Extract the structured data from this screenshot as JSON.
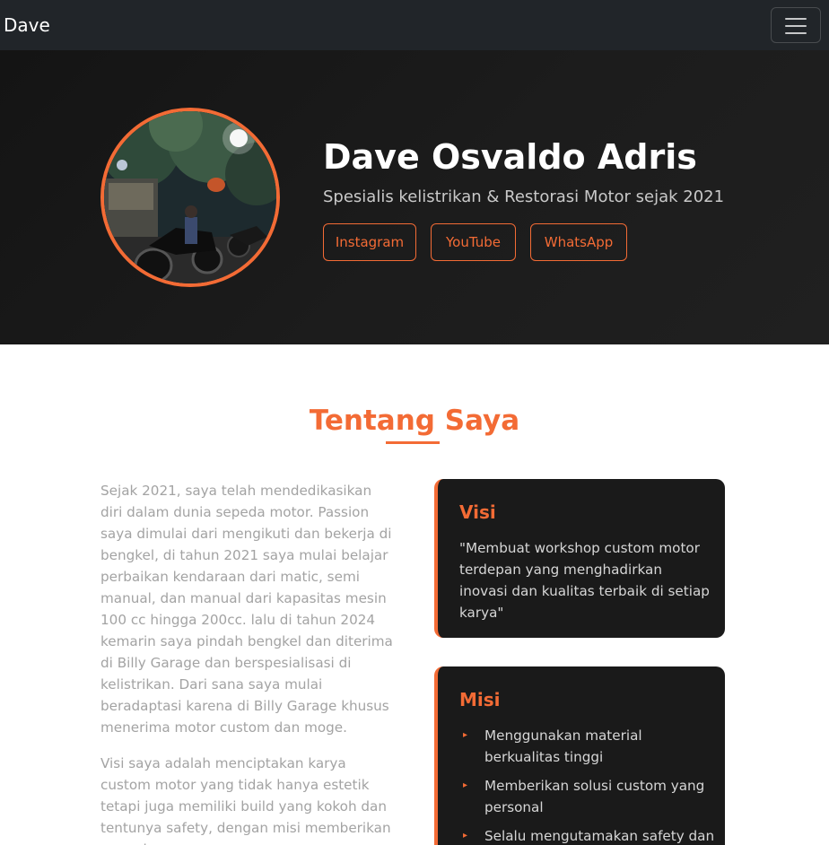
{
  "navbar": {
    "brand": "Dave",
    "toggle_icon": "hamburger-menu-icon"
  },
  "hero": {
    "name": "Dave Osvaldo Adris",
    "subtitle": "Spesialis kelistrikan & Restorasi Motor sejak 2021",
    "buttons": [
      {
        "label": "Instagram"
      },
      {
        "label": "YouTube"
      },
      {
        "label": "WhatsApp"
      }
    ]
  },
  "about": {
    "title": "Tentang Saya",
    "paragraphs": [
      "Sejak 2021, saya telah mendedikasikan diri dalam dunia sepeda motor. Passion saya dimulai dari mengikuti dan bekerja di bengkel, di tahun 2021 saya mulai belajar perbaikan kendaraan dari matic, semi manual, dan manual dari kapasitas mesin 100 cc hingga 200cc. lalu di tahun 2024 kemarin saya pindah bengkel dan diterima di Billy Garage dan berspesialisasi di kelistrikan. Dari sana saya mulai beradaptasi karena di Billy Garage khusus menerima motor custom dan moge.",
      "Visi saya adalah menciptakan karya custom motor yang tidak hanya estetik tetapi juga memiliki build yang kokoh dan tentunya safety, dengan misi memberikan pengalaman"
    ],
    "visi": {
      "title": "Visi",
      "text": "\"Membuat workshop custom motor terdepan yang menghadirkan inovasi dan kualitas terbaik di setiap karya\""
    },
    "misi": {
      "title": "Misi",
      "items": [
        "Menggunakan material berkualitas tinggi",
        "Memberikan solusi custom yang personal",
        "Selalu mengutamakan safety dan"
      ]
    }
  },
  "colors": {
    "accent": "#f36b35",
    "navbar": "#212529",
    "hero_bg": "#1a1a1a",
    "card_bg": "#1a1a1a"
  }
}
